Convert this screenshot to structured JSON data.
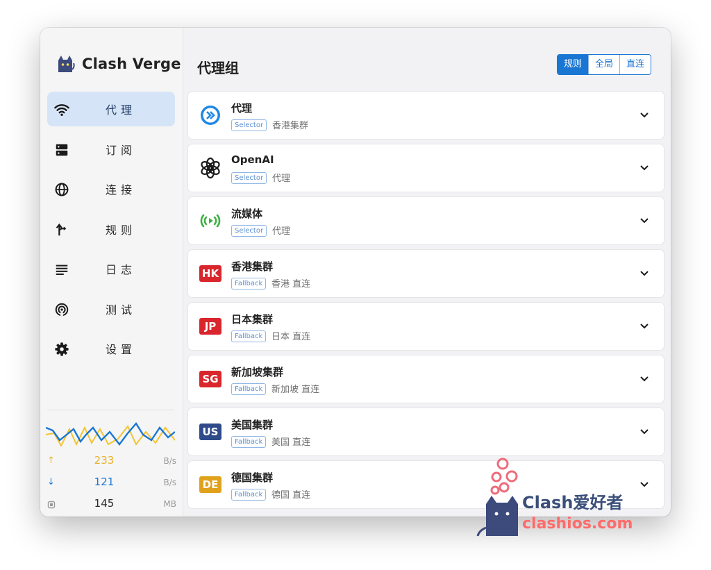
{
  "app": {
    "name": "Clash Verge"
  },
  "sidebar": {
    "items": [
      {
        "label": "代理",
        "icon": "wifi-icon",
        "active": true
      },
      {
        "label": "订阅",
        "icon": "storage-icon",
        "active": false
      },
      {
        "label": "连接",
        "icon": "globe-icon",
        "active": false
      },
      {
        "label": "规则",
        "icon": "fork-icon",
        "active": false
      },
      {
        "label": "日志",
        "icon": "lines-icon",
        "active": false
      },
      {
        "label": "测试",
        "icon": "radar-icon",
        "active": false
      },
      {
        "label": "设置",
        "icon": "gear-icon",
        "active": false
      }
    ],
    "stats": {
      "upload": {
        "value": "233",
        "unit": "B/s",
        "icon": "arrow-up-icon",
        "color": "#e8b325"
      },
      "download": {
        "value": "121",
        "unit": "B/s",
        "icon": "arrow-down-icon",
        "color": "#1976d2"
      },
      "memory": {
        "value": "145",
        "unit": "MB",
        "icon": "memory-icon"
      }
    }
  },
  "header": {
    "title": "代理组",
    "modes": [
      {
        "label": "规则",
        "active": true
      },
      {
        "label": "全局",
        "active": false
      },
      {
        "label": "直连",
        "active": false
      }
    ]
  },
  "groups": [
    {
      "name": "代理",
      "type": "Selector",
      "now": "香港集群",
      "icon": "forward-circle-icon"
    },
    {
      "name": "OpenAI",
      "type": "Selector",
      "now": "代理",
      "icon": "openai-logo-icon"
    },
    {
      "name": "流媒体",
      "type": "Selector",
      "now": "代理",
      "icon": "streaming-icon"
    },
    {
      "name": "香港集群",
      "type": "Fallback",
      "now": "香港 直连",
      "icon": "flag-hk-icon",
      "badge": "HK",
      "color": "#d9262c"
    },
    {
      "name": "日本集群",
      "type": "Fallback",
      "now": "日本 直连",
      "icon": "flag-jp-icon",
      "badge": "JP",
      "color": "#d9262c"
    },
    {
      "name": "新加坡集群",
      "type": "Fallback",
      "now": "新加坡 直连",
      "icon": "flag-sg-icon",
      "badge": "SG",
      "color": "#d9262c"
    },
    {
      "name": "美国集群",
      "type": "Fallback",
      "now": "美国 直连",
      "icon": "flag-us-icon",
      "badge": "US",
      "color": "#2f4a8a"
    },
    {
      "name": "德国集群",
      "type": "Fallback",
      "now": "德国 直连",
      "icon": "flag-de-icon",
      "badge": "DE",
      "color": "#e0a11b"
    }
  ],
  "watermark": {
    "title": "Clash爱好者",
    "site": "clashios.com"
  },
  "colors": {
    "accent": "#1976d2",
    "active_nav_bg": "#d6e4f7"
  }
}
